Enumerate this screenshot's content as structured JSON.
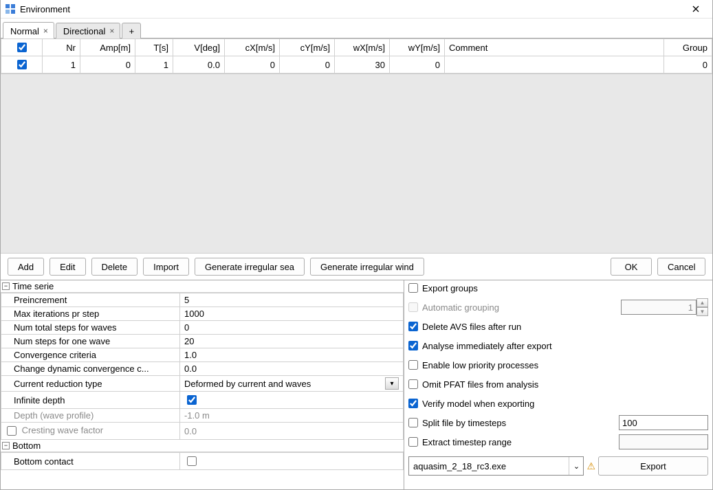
{
  "window": {
    "title": "Environment"
  },
  "tabs": [
    {
      "label": "Normal",
      "active": true
    },
    {
      "label": "Directional",
      "active": false
    }
  ],
  "grid": {
    "headers": {
      "nr": "Nr",
      "amp": "Amp[m]",
      "t": "T[s]",
      "v": "V[deg]",
      "cx": "cX[m/s]",
      "cy": "cY[m/s]",
      "wx": "wX[m/s]",
      "wy": "wY[m/s]",
      "comment": "Comment",
      "group": "Group"
    },
    "row": {
      "nr": "1",
      "amp": "0",
      "t": "1",
      "v": "0.0",
      "cx": "0",
      "cy": "0",
      "wx": "30",
      "wy": "0",
      "comment": "",
      "group": "0"
    }
  },
  "buttons": {
    "add": "Add",
    "edit": "Edit",
    "delete": "Delete",
    "import": "Import",
    "gen_sea": "Generate irregular sea",
    "gen_wind": "Generate irregular wind",
    "ok": "OK",
    "cancel": "Cancel"
  },
  "props": {
    "section1_title": "Time serie",
    "preincrement_label": "Preincrement",
    "preincrement_value": "5",
    "maxiter_label": "Max iterations pr step",
    "maxiter_value": "1000",
    "totalsteps_label": "Num total steps for waves",
    "totalsteps_value": "0",
    "onewave_label": "Num steps for one wave",
    "onewave_value": "20",
    "conv_label": "Convergence criteria",
    "conv_value": "1.0",
    "dynconv_label": "Change dynamic convergence c...",
    "dynconv_value": "0.0",
    "cred_label": "Current reduction type",
    "cred_value": "Deformed by current and waves",
    "infdepth_label": "Infinite depth",
    "depth_label": "Depth (wave profile)",
    "depth_value": "-1.0 m",
    "cresting_label": "Cresting wave factor",
    "cresting_value": "0.0",
    "section2_title": "Bottom",
    "bottom_contact_label": "Bottom contact"
  },
  "export": {
    "export_groups": "Export groups",
    "auto_group": "Automatic grouping",
    "auto_group_value": "1",
    "del_avs": "Delete AVS files after run",
    "analyse": "Analyse immediately after export",
    "lowpri": "Enable low priority processes",
    "omitpfat": "Omit PFAT files from analysis",
    "verify": "Verify model when exporting",
    "split": "Split file by timesteps",
    "split_value": "100",
    "extract": "Extract timestep range",
    "extract_value": "",
    "exe": "aquasim_2_18_rc3.exe",
    "export_btn": "Export"
  }
}
